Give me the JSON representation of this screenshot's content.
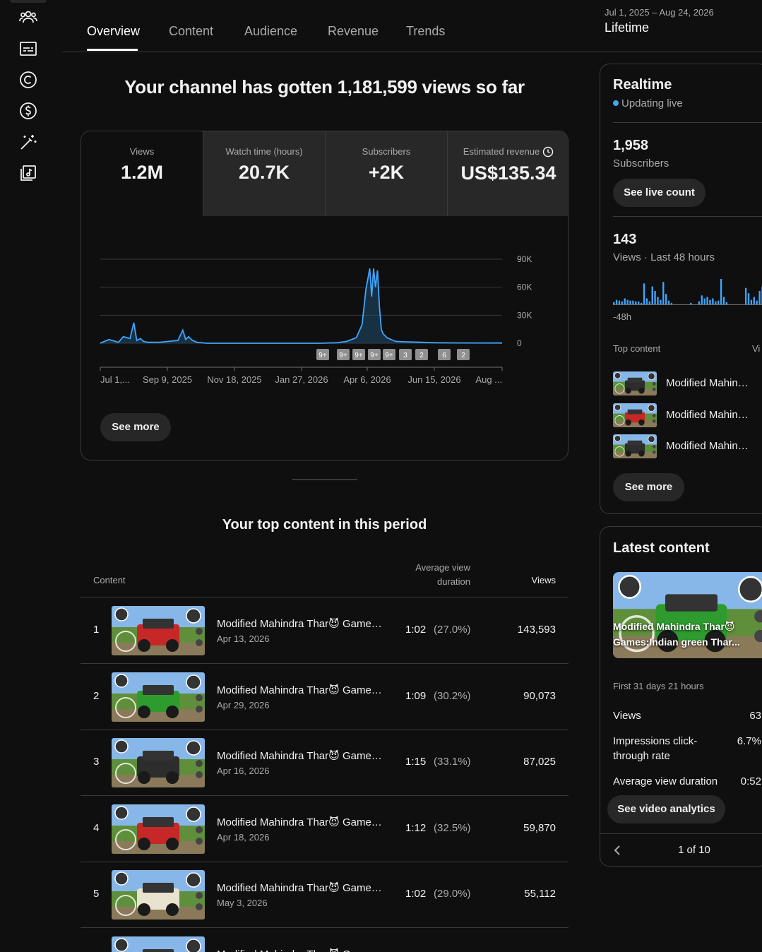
{
  "rail": {
    "icons": [
      "people-icon",
      "subtitles-icon",
      "copyright-icon",
      "monetization-icon",
      "customization-icon",
      "audio-library-icon"
    ]
  },
  "tabs": [
    {
      "label": "Overview",
      "active": true
    },
    {
      "label": "Content"
    },
    {
      "label": "Audience"
    },
    {
      "label": "Revenue"
    },
    {
      "label": "Trends"
    }
  ],
  "period": {
    "range": "Jul 1, 2025 – Aug 24, 2026",
    "label": "Lifetime"
  },
  "headline": "Your channel has gotten 1,181,599 views so far",
  "metrics": [
    {
      "label": "Views",
      "value": "1.2M"
    },
    {
      "label": "Watch time (hours)",
      "value": "20.7K"
    },
    {
      "label": "Subscribers",
      "value": "+2K"
    },
    {
      "label": "Estimated revenue",
      "value": "US$135.34"
    }
  ],
  "chart_data": {
    "type": "line",
    "title": "",
    "xlabel": "",
    "ylabel": "",
    "ylim": [
      0,
      90000
    ],
    "y_ticks": [
      "0",
      "30K",
      "60K",
      "90K"
    ],
    "x_tick_labels": [
      "Jul 1,...",
      "Sep 9, 2025",
      "Nov 18, 2025",
      "Jan 27, 2026",
      "Apr 6, 2026",
      "Jun 15, 2026",
      "Aug ..."
    ],
    "grid": true,
    "series": [
      {
        "x": [
          "2025-07-01",
          "2025-07-10",
          "2025-07-20",
          "2025-07-25",
          "2025-08-01",
          "2025-08-05",
          "2025-08-08",
          "2025-08-12",
          "2025-08-15",
          "2025-08-20",
          "2025-09-01",
          "2025-09-10",
          "2025-09-20",
          "2025-09-25",
          "2025-09-28",
          "2025-10-01",
          "2025-10-05",
          "2025-10-10",
          "2025-10-20",
          "2025-11-01",
          "2025-11-18",
          "2025-12-15",
          "2026-01-10",
          "2026-01-27",
          "2026-02-15",
          "2026-03-05",
          "2026-03-15",
          "2026-03-25",
          "2026-03-31",
          "2026-04-04",
          "2026-04-08",
          "2026-04-10",
          "2026-04-12",
          "2026-04-14",
          "2026-04-16",
          "2026-04-18",
          "2026-04-20",
          "2026-04-22",
          "2026-04-26",
          "2026-04-30",
          "2026-05-05",
          "2026-05-15",
          "2026-06-01",
          "2026-06-15",
          "2026-07-10",
          "2026-08-24"
        ],
        "values": [
          0,
          4000,
          1000,
          7000,
          5000,
          22000,
          3000,
          5000,
          2000,
          1000,
          1000,
          2000,
          3000,
          14000,
          4000,
          7000,
          3000,
          1000,
          0,
          0,
          0,
          0,
          0,
          0,
          0,
          500,
          2000,
          6000,
          20000,
          58000,
          80000,
          50000,
          80000,
          60000,
          78000,
          40000,
          15000,
          10000,
          6000,
          4000,
          2000,
          1500,
          1000,
          500,
          300,
          200
        ]
      }
    ],
    "annotations": [
      "9+",
      "9+",
      "9+",
      "9+",
      "9+",
      "3",
      "2",
      "6",
      "2"
    ]
  },
  "see_more": "See more",
  "top_content": {
    "title": "Your top content in this period",
    "columns": {
      "content": "Content",
      "avd_line1": "Average view",
      "avd_line2": "duration",
      "views": "Views"
    },
    "rows": [
      {
        "rank": "1",
        "title": "Modified Mahindra Thar😈 Games:Indian green Thar...",
        "date": "Apr 13, 2026",
        "duration": "1:02",
        "percent": "(27.0%)",
        "views": "143,593",
        "car": "#c62828"
      },
      {
        "rank": "2",
        "title": "Modified Mahindra Thar😈 Games:Indian green Thar...",
        "date": "Apr 29, 2026",
        "duration": "1:09",
        "percent": "(30.2%)",
        "views": "90,073",
        "car": "#2e9b2e"
      },
      {
        "rank": "3",
        "title": "Modified Mahindra Thar😈 Games:Indian green Thar...",
        "date": "Apr 16, 2026",
        "duration": "1:15",
        "percent": "(33.1%)",
        "views": "87,025",
        "car": "#2d2d2d"
      },
      {
        "rank": "4",
        "title": "Modified Mahindra Thar😈 Games:Indian green Thar...",
        "date": "Apr 18, 2026",
        "duration": "1:12",
        "percent": "(32.5%)",
        "views": "59,870",
        "car": "#c62828"
      },
      {
        "rank": "5",
        "title": "Modified Mahindra Thar😈 Games:Indian green Thar...",
        "date": "May 3, 2026",
        "duration": "1:02",
        "percent": "(29.0%)",
        "views": "55,112",
        "car": "#e8e2cf"
      },
      {
        "rank": "",
        "title": "Modified Mahindra Thar😈 Game",
        "date": "",
        "duration": "",
        "percent": "",
        "views": "",
        "car": "#c62828"
      }
    ]
  },
  "realtime": {
    "title": "Realtime",
    "status": "Updating live",
    "subscribers_value": "1,958",
    "subscribers_label": "Subscribers",
    "live_count_button": "See live count",
    "views_value": "143",
    "views_label": "Views · Last 48 hours",
    "spark_start_label": "-48h",
    "spark_bars": [
      3,
      6,
      5,
      4,
      8,
      6,
      5,
      5,
      4,
      4,
      2,
      28,
      8,
      4,
      24,
      18,
      10,
      6,
      30,
      14,
      5,
      2,
      0,
      0,
      0,
      0,
      0,
      0,
      2,
      0,
      0,
      4,
      12,
      8,
      10,
      6,
      8,
      4,
      5,
      34,
      10,
      3,
      0,
      0,
      0,
      0,
      0,
      0,
      22,
      15,
      6,
      10,
      5,
      18,
      24,
      30,
      12
    ],
    "top_content_label": "Top content",
    "top_content_right": "Vi",
    "top_items": [
      {
        "title": "Modified Mahindra Thar😈 Games",
        "car": "#2d2d2d"
      },
      {
        "title": "Modified Mahindra Thar😈 Games",
        "car": "#c62828"
      },
      {
        "title": "Modified Mahindra Thar😈 Games",
        "car": "#2d2d2d"
      }
    ],
    "see_more": "See more"
  },
  "latest": {
    "title": "Latest content",
    "caption_line1": "Modified Mahindra Thar😈",
    "caption_line2": "Games:Indian green Thar...",
    "period_label": "First 31 days 21 hours",
    "stats": [
      {
        "label": "Views",
        "value": "63"
      },
      {
        "label": "Impressions click-through rate",
        "value": "6.7%"
      },
      {
        "label": "Average view duration",
        "value": "0:52"
      }
    ],
    "analytics_button": "See video analytics",
    "pager": "1 of 10"
  }
}
